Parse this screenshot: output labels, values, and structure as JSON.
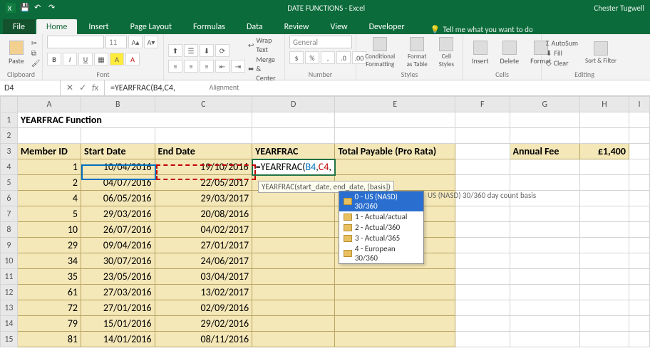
{
  "titlebar": {
    "center": "DATE FUNCTIONS - Excel",
    "right": "Chester Tugwell"
  },
  "tabs": {
    "file": "File",
    "home": "Home",
    "insert": "Insert",
    "page_layout": "Page Layout",
    "formulas": "Formulas",
    "data": "Data",
    "review": "Review",
    "view": "View",
    "developer": "Developer",
    "tellme": "Tell me what you want to do"
  },
  "ribbon": {
    "clipboard": {
      "paste": "Paste",
      "label": "Clipboard"
    },
    "font": {
      "name_placeholder": "",
      "size_placeholder": "11",
      "label": "Font"
    },
    "alignment": {
      "wrap": "Wrap Text",
      "merge": "Merge & Center",
      "label": "Alignment"
    },
    "number": {
      "format": "General",
      "label": "Number"
    },
    "styles": {
      "cond": "Conditional Formatting",
      "table": "Format as Table",
      "cell": "Cell Styles",
      "label": "Styles"
    },
    "cells": {
      "insert": "Insert",
      "delete": "Delete",
      "format": "Format",
      "label": "Cells"
    },
    "editing": {
      "autosum": "AutoSum",
      "fill": "Fill",
      "clear": "Clear",
      "sort": "Sort & Filter",
      "label": "Editing"
    }
  },
  "namebox": "D4",
  "fx_label": "fx",
  "formula": "=YEARFRAC(B4,C4,",
  "columns": [
    "A",
    "B",
    "C",
    "D",
    "E",
    "F",
    "G",
    "H",
    "I"
  ],
  "title": "YEARFRAC Function",
  "headers": {
    "member": "Member ID",
    "start": "Start Date",
    "end": "End Date",
    "yf": "YEARFRAC",
    "total": "Total Payable (Pro Rata)",
    "fee_label": "Annual Fee",
    "fee_value": "£1,400"
  },
  "rows": [
    {
      "n": 4,
      "id": "1",
      "start": "10/04/2016",
      "end": "19/10/2016"
    },
    {
      "n": 5,
      "id": "2",
      "start": "04/07/2016",
      "end": "22/05/2017"
    },
    {
      "n": 6,
      "id": "4",
      "start": "06/05/2016",
      "end": "29/03/2017"
    },
    {
      "n": 7,
      "id": "5",
      "start": "29/03/2016",
      "end": "20/08/2016"
    },
    {
      "n": 8,
      "id": "10",
      "start": "26/07/2016",
      "end": "04/02/2017"
    },
    {
      "n": 9,
      "id": "29",
      "start": "09/04/2016",
      "end": "27/01/2017"
    },
    {
      "n": 10,
      "id": "34",
      "start": "30/07/2016",
      "end": "24/06/2017"
    },
    {
      "n": 11,
      "id": "35",
      "start": "23/05/2016",
      "end": "03/04/2017"
    },
    {
      "n": 12,
      "id": "61",
      "start": "27/03/2016",
      "end": "13/02/2017"
    },
    {
      "n": 13,
      "id": "72",
      "start": "27/01/2016",
      "end": "02/09/2016"
    },
    {
      "n": 14,
      "id": "79",
      "start": "15/01/2016",
      "end": "29/02/2016"
    },
    {
      "n": 15,
      "id": "81",
      "start": "14/01/2016",
      "end": "08/11/2016"
    }
  ],
  "cell_formula": {
    "pre": "=YEARFRAC(",
    "a": "B4",
    "m": ",",
    "b": "C4",
    "post": ","
  },
  "tooltip": "YEARFRAC(start_date, end_date, [basis])",
  "intelli": [
    "0 - US (NASD) 30/360",
    "1 - Actual/actual",
    "2 - Actual/360",
    "3 - Actual/365",
    "4 - European 30/360"
  ],
  "intelli_desc": "US (NASD) 30/360 day count basis"
}
